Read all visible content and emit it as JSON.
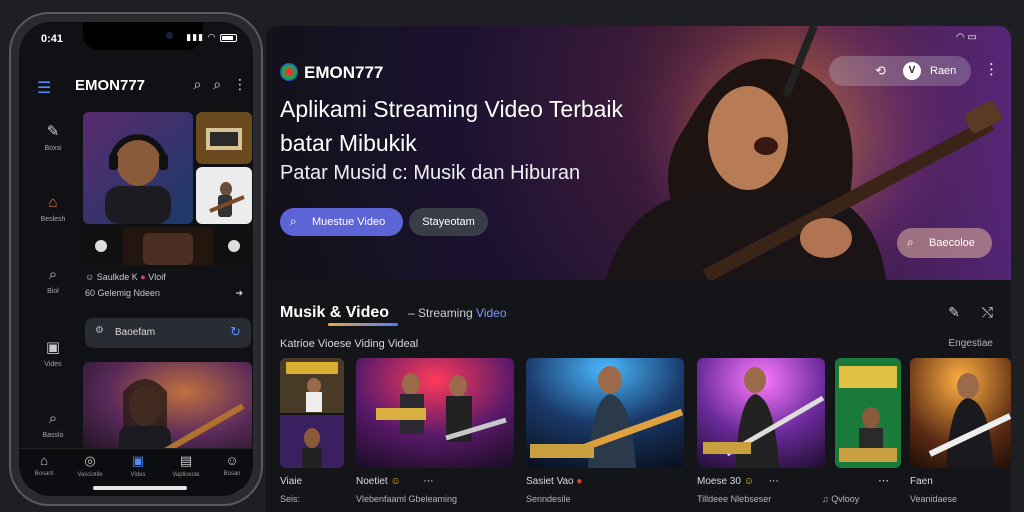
{
  "phone": {
    "status_time": "0:41",
    "brand": "EMON777",
    "rail": [
      {
        "icon": "pen-icon",
        "label": "Boxsi"
      },
      {
        "icon": "home-icon",
        "label": "Beslesh"
      },
      {
        "icon": "search-icon",
        "label": "Biol"
      },
      {
        "icon": "video-icon",
        "label": "Vides"
      },
      {
        "icon": "search-icon",
        "label": "Basslo"
      }
    ],
    "tile_captions": {
      "line1": "Saulkde K",
      "line1b": "Vloif",
      "line2": "60 Gelemig Ndeen"
    },
    "search": {
      "text": "Baoefam"
    },
    "tabs": [
      "Bosant",
      "Vasciotile",
      "Vides",
      "Vapliceste",
      "Bosan"
    ]
  },
  "hero": {
    "brand": "EMON777",
    "title_line1": "Aplikami Streaming Video Terbaik",
    "title_line2": "batar Mibukik",
    "title_line3": "Patar Musid c: Musik dan Hiburan",
    "btn_primary": "Muestue Video",
    "btn_secondary": "Stayeotam",
    "pill_avatar": "V",
    "pill_label": "Raen",
    "cta_label": "Baecoloe"
  },
  "section": {
    "title_left": "Musik",
    "title_right": "& Video",
    "subtitle_prefix": "– Streaming",
    "subtitle_highlight": "Video",
    "row_label": "Katrioe Vioese Viding Videal",
    "row_right": "Engestiae"
  },
  "cards": [
    {
      "title": "Viaie",
      "sub": "Seis:"
    },
    {
      "title": "Noetiet",
      "sub": "Vlebenfaaml Gbeleaming"
    },
    {
      "title": "Sasiet Vao",
      "sub": "Senndesile"
    },
    {
      "title": "Moese 30",
      "sub": "Tilldeee Nlebseser"
    },
    {
      "title": "",
      "sub": "Qvlooy"
    },
    {
      "title": "Faen",
      "sub": "Veanidaese"
    }
  ],
  "colors": {
    "accent": "#5d64d6",
    "brand_ring": "#2a9d4c",
    "highlight": "#7f9dff"
  }
}
